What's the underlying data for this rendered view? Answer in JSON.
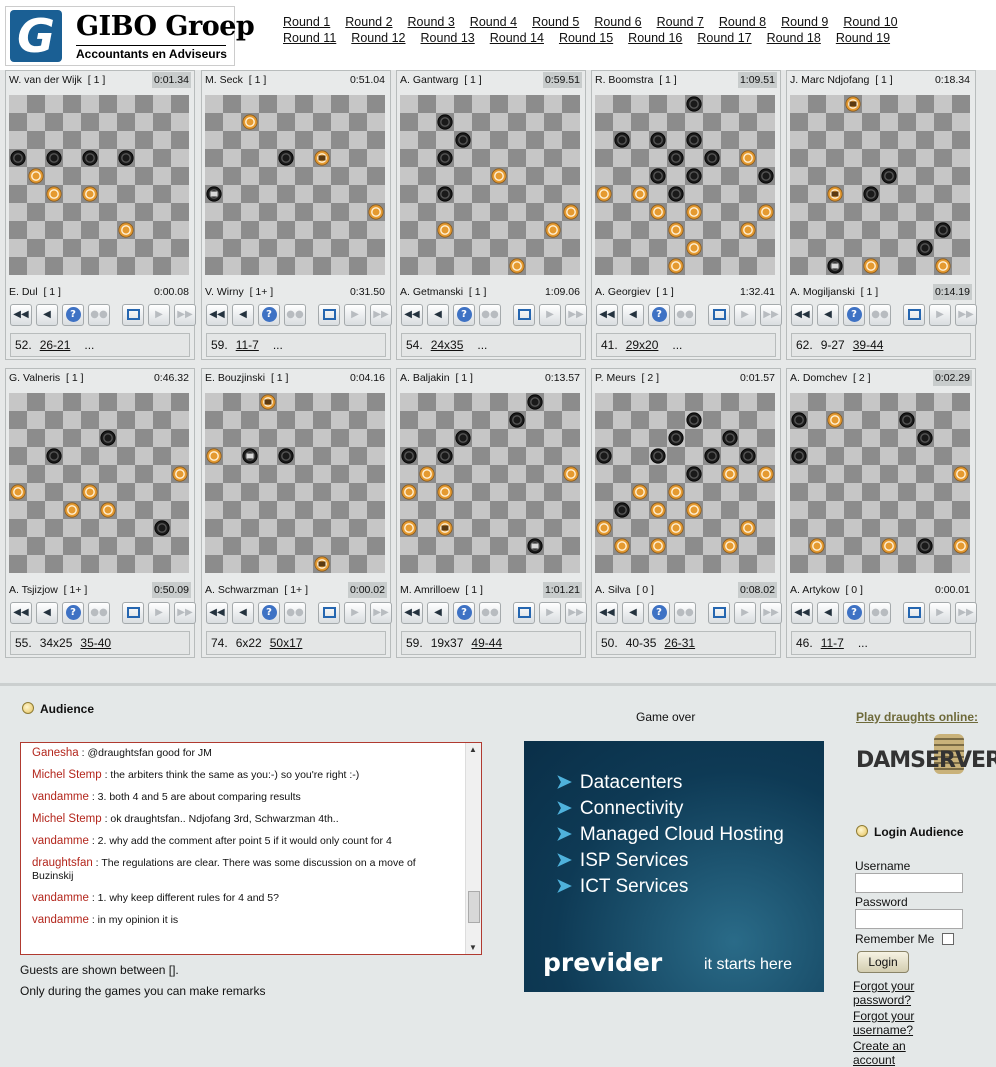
{
  "header": {
    "logo_mark": "G",
    "logo_name": "GIBO Groep",
    "logo_sub": "Accountants en Adviseurs",
    "rounds_row1": [
      "Round 1",
      "Round 2",
      "Round 3",
      "Round 4",
      "Round 5",
      "Round 6",
      "Round 7",
      "Round 8",
      "Round 9",
      "Round 10"
    ],
    "rounds_row2": [
      "Round 11",
      "Round 12",
      "Round 13",
      "Round 14",
      "Round 15",
      "Round 16",
      "Round 17",
      "Round 18",
      "Round 19"
    ]
  },
  "colors": {
    "black_piece": "#1a1a1a",
    "white_piece": "#e59a30",
    "dark_square": "#8c8c8c",
    "light_square": "#c6c6c6",
    "chat_user": "#b3261c",
    "chat_border": "#b03a30"
  },
  "controls": [
    "first-icon",
    "prev-icon",
    "help-icon",
    "pause-icon",
    "flip-icon",
    "next-icon",
    "last-icon"
  ],
  "games": [
    {
      "top": {
        "name": "W. van der Wijk",
        "score": "[ 1 ]",
        "clock": "0:01.34",
        "active": true
      },
      "bottom": {
        "name": "E. Dul",
        "score": "[ 1 ]",
        "clock": "0:00.08",
        "active": false
      },
      "moves": {
        "num": "52.",
        "plain": "",
        "link": "26-21",
        "ellipsis": "..."
      },
      "pieces": [
        {
          "c": 0,
          "r": 3,
          "col": "b"
        },
        {
          "c": 2,
          "r": 3,
          "col": "b"
        },
        {
          "c": 4,
          "r": 3,
          "col": "b"
        },
        {
          "c": 6,
          "r": 3,
          "col": "b"
        },
        {
          "c": 1,
          "r": 4,
          "col": "w"
        },
        {
          "c": 2,
          "r": 5,
          "col": "w"
        },
        {
          "c": 4,
          "r": 5,
          "col": "w"
        },
        {
          "c": 6,
          "r": 7,
          "col": "w"
        }
      ]
    },
    {
      "top": {
        "name": "M. Seck",
        "score": "[ 1 ]",
        "clock": "0:51.04",
        "active": false
      },
      "bottom": {
        "name": "V. Wirny",
        "score": "[ 1+ ]",
        "clock": "0:31.50",
        "active": false
      },
      "moves": {
        "num": "59.",
        "plain": "",
        "link": "11-7",
        "ellipsis": "..."
      },
      "pieces": [
        {
          "c": 2,
          "r": 1,
          "col": "w"
        },
        {
          "c": 4,
          "r": 3,
          "col": "b"
        },
        {
          "c": 6,
          "r": 3,
          "col": "wk"
        },
        {
          "c": 0,
          "r": 5,
          "col": "bk"
        },
        {
          "c": 9,
          "r": 6,
          "col": "w"
        }
      ]
    },
    {
      "top": {
        "name": "A. Gantwarg",
        "score": "[ 1 ]",
        "clock": "0:59.51",
        "active": true
      },
      "bottom": {
        "name": "A. Getmanski",
        "score": "[ 1 ]",
        "clock": "1:09.06",
        "active": false
      },
      "moves": {
        "num": "54.",
        "plain": "",
        "link": "24x35",
        "ellipsis": "..."
      },
      "pieces": [
        {
          "c": 2,
          "r": 1,
          "col": "b"
        },
        {
          "c": 3,
          "r": 2,
          "col": "b"
        },
        {
          "c": 2,
          "r": 3,
          "col": "b"
        },
        {
          "c": 5,
          "r": 4,
          "col": "w"
        },
        {
          "c": 2,
          "r": 5,
          "col": "b"
        },
        {
          "c": 9,
          "r": 6,
          "col": "w"
        },
        {
          "c": 2,
          "r": 7,
          "col": "w"
        },
        {
          "c": 8,
          "r": 7,
          "col": "w"
        },
        {
          "c": 6,
          "r": 9,
          "col": "w"
        }
      ]
    },
    {
      "top": {
        "name": "R. Boomstra",
        "score": "[ 1 ]",
        "clock": "1:09.51",
        "active": true
      },
      "bottom": {
        "name": "A. Georgiev",
        "score": "[ 1 ]",
        "clock": "1:32.41",
        "active": false
      },
      "moves": {
        "num": "41.",
        "plain": "",
        "link": "29x20",
        "ellipsis": "..."
      },
      "pieces": [
        {
          "c": 5,
          "r": 0,
          "col": "b"
        },
        {
          "c": 3,
          "r": 2,
          "col": "b"
        },
        {
          "c": 5,
          "r": 2,
          "col": "b"
        },
        {
          "c": 1,
          "r": 2,
          "col": "b"
        },
        {
          "c": 4,
          "r": 3,
          "col": "b"
        },
        {
          "c": 6,
          "r": 3,
          "col": "b"
        },
        {
          "c": 8,
          "r": 3,
          "col": "w"
        },
        {
          "c": 3,
          "r": 4,
          "col": "b"
        },
        {
          "c": 5,
          "r": 4,
          "col": "b"
        },
        {
          "c": 9,
          "r": 4,
          "col": "b"
        },
        {
          "c": 0,
          "r": 5,
          "col": "w"
        },
        {
          "c": 2,
          "r": 5,
          "col": "w"
        },
        {
          "c": 4,
          "r": 5,
          "col": "b"
        },
        {
          "c": 3,
          "r": 6,
          "col": "w"
        },
        {
          "c": 5,
          "r": 6,
          "col": "w"
        },
        {
          "c": 9,
          "r": 6,
          "col": "w"
        },
        {
          "c": 4,
          "r": 7,
          "col": "w"
        },
        {
          "c": 8,
          "r": 7,
          "col": "w"
        },
        {
          "c": 5,
          "r": 8,
          "col": "w"
        },
        {
          "c": 4,
          "r": 9,
          "col": "w"
        }
      ]
    },
    {
      "top": {
        "name": "J. Marc Ndjofang",
        "score": "[ 1 ]",
        "clock": "0:18.34",
        "active": false
      },
      "bottom": {
        "name": "A. Mogiljanski",
        "score": "[ 1 ]",
        "clock": "0:14.19",
        "active": true
      },
      "moves": {
        "num": "62.",
        "plain": "9-27",
        "link": "39-44",
        "ellipsis": ""
      },
      "pieces": [
        {
          "c": 3,
          "r": 0,
          "col": "wk"
        },
        {
          "c": 5,
          "r": 4,
          "col": "b"
        },
        {
          "c": 2,
          "r": 5,
          "col": "wk"
        },
        {
          "c": 4,
          "r": 5,
          "col": "b"
        },
        {
          "c": 8,
          "r": 7,
          "col": "b"
        },
        {
          "c": 7,
          "r": 8,
          "col": "b"
        },
        {
          "c": 2,
          "r": 9,
          "col": "bk"
        },
        {
          "c": 4,
          "r": 9,
          "col": "w"
        },
        {
          "c": 8,
          "r": 9,
          "col": "w"
        }
      ]
    },
    {
      "top": {
        "name": "G. Valneris",
        "score": "[ 1 ]",
        "clock": "0:46.32",
        "active": false
      },
      "bottom": {
        "name": "A. Tsjizjow",
        "score": "[ 1+ ]",
        "clock": "0:50.09",
        "active": true
      },
      "moves": {
        "num": "55.",
        "plain": "34x25",
        "link": "35-40",
        "ellipsis": ""
      },
      "pieces": [
        {
          "c": 5,
          "r": 2,
          "col": "b"
        },
        {
          "c": 2,
          "r": 3,
          "col": "b"
        },
        {
          "c": 9,
          "r": 4,
          "col": "w"
        },
        {
          "c": 0,
          "r": 5,
          "col": "w"
        },
        {
          "c": 4,
          "r": 5,
          "col": "w"
        },
        {
          "c": 3,
          "r": 6,
          "col": "w"
        },
        {
          "c": 5,
          "r": 6,
          "col": "w"
        },
        {
          "c": 8,
          "r": 7,
          "col": "b"
        }
      ]
    },
    {
      "top": {
        "name": "E. Bouzjinski",
        "score": "[ 1 ]",
        "clock": "0:04.16",
        "active": false
      },
      "bottom": {
        "name": "A. Schwarzman",
        "score": "[ 1+ ]",
        "clock": "0:00.02",
        "active": true
      },
      "moves": {
        "num": "74.",
        "plain": "6x22",
        "link": "50x17",
        "ellipsis": ""
      },
      "pieces": [
        {
          "c": 3,
          "r": 0,
          "col": "wk"
        },
        {
          "c": 0,
          "r": 3,
          "col": "w"
        },
        {
          "c": 2,
          "r": 3,
          "col": "bk"
        },
        {
          "c": 4,
          "r": 3,
          "col": "b"
        },
        {
          "c": 6,
          "r": 9,
          "col": "wk"
        }
      ]
    },
    {
      "top": {
        "name": "A. Baljakin",
        "score": "[ 1 ]",
        "clock": "0:13.57",
        "active": false
      },
      "bottom": {
        "name": "M. Amrilloew",
        "score": "[ 1 ]",
        "clock": "1:01.21",
        "active": true
      },
      "moves": {
        "num": "59.",
        "plain": "19x37",
        "link": "49-44",
        "ellipsis": ""
      },
      "pieces": [
        {
          "c": 7,
          "r": 0,
          "col": "b"
        },
        {
          "c": 6,
          "r": 1,
          "col": "b"
        },
        {
          "c": 3,
          "r": 2,
          "col": "b"
        },
        {
          "c": 0,
          "r": 3,
          "col": "b"
        },
        {
          "c": 2,
          "r": 3,
          "col": "b"
        },
        {
          "c": 1,
          "r": 4,
          "col": "w"
        },
        {
          "c": 9,
          "r": 4,
          "col": "w"
        },
        {
          "c": 0,
          "r": 5,
          "col": "w"
        },
        {
          "c": 2,
          "r": 5,
          "col": "w"
        },
        {
          "c": 0,
          "r": 7,
          "col": "w"
        },
        {
          "c": 2,
          "r": 7,
          "col": "wk"
        },
        {
          "c": 7,
          "r": 8,
          "col": "bk"
        }
      ]
    },
    {
      "top": {
        "name": "P. Meurs",
        "score": "[ 2 ]",
        "clock": "0:01.57",
        "active": false
      },
      "bottom": {
        "name": "A. Silva",
        "score": "[ 0 ]",
        "clock": "0:08.02",
        "active": true
      },
      "moves": {
        "num": "50.",
        "plain": "40-35",
        "link": "26-31",
        "ellipsis": ""
      },
      "pieces": [
        {
          "c": 5,
          "r": 1,
          "col": "b"
        },
        {
          "c": 4,
          "r": 2,
          "col": "b"
        },
        {
          "c": 7,
          "r": 2,
          "col": "b"
        },
        {
          "c": 0,
          "r": 3,
          "col": "b"
        },
        {
          "c": 3,
          "r": 3,
          "col": "b"
        },
        {
          "c": 6,
          "r": 3,
          "col": "b"
        },
        {
          "c": 8,
          "r": 3,
          "col": "b"
        },
        {
          "c": 5,
          "r": 4,
          "col": "b"
        },
        {
          "c": 7,
          "r": 4,
          "col": "w"
        },
        {
          "c": 9,
          "r": 4,
          "col": "w"
        },
        {
          "c": 2,
          "r": 5,
          "col": "w"
        },
        {
          "c": 4,
          "r": 5,
          "col": "w"
        },
        {
          "c": 1,
          "r": 6,
          "col": "b"
        },
        {
          "c": 3,
          "r": 6,
          "col": "w"
        },
        {
          "c": 5,
          "r": 6,
          "col": "w"
        },
        {
          "c": 0,
          "r": 7,
          "col": "w"
        },
        {
          "c": 4,
          "r": 7,
          "col": "w"
        },
        {
          "c": 8,
          "r": 7,
          "col": "w"
        },
        {
          "c": 3,
          "r": 8,
          "col": "w"
        },
        {
          "c": 1,
          "r": 8,
          "col": "w"
        },
        {
          "c": 7,
          "r": 8,
          "col": "w"
        }
      ]
    },
    {
      "top": {
        "name": "A. Domchev",
        "score": "[ 2 ]",
        "clock": "0:02.29",
        "active": true
      },
      "bottom": {
        "name": "A. Artykow",
        "score": "[ 0 ]",
        "clock": "0:00.01",
        "active": false
      },
      "moves": {
        "num": "46.",
        "plain": "",
        "link": "11-7",
        "ellipsis": "..."
      },
      "pieces": [
        {
          "c": 0,
          "r": 1,
          "col": "b"
        },
        {
          "c": 2,
          "r": 1,
          "col": "w"
        },
        {
          "c": 6,
          "r": 1,
          "col": "b"
        },
        {
          "c": 7,
          "r": 2,
          "col": "b"
        },
        {
          "c": 0,
          "r": 3,
          "col": "b"
        },
        {
          "c": 9,
          "r": 4,
          "col": "w"
        },
        {
          "c": 1,
          "r": 8,
          "col": "w"
        },
        {
          "c": 5,
          "r": 8,
          "col": "w"
        },
        {
          "c": 7,
          "r": 8,
          "col": "b"
        },
        {
          "c": 9,
          "r": 8,
          "col": "w"
        }
      ]
    }
  ],
  "audience": {
    "title": "Audience",
    "chat": [
      {
        "user": "Ganesha",
        "text": ": @draughtsfan good for JM"
      },
      {
        "user": "Michel Stemp",
        "text": ": the arbiters think the same as you:-) so you're right :-)"
      },
      {
        "user": "vandamme",
        "text": ": 3. both 4 and 5 are about comparing results"
      },
      {
        "user": "Michel Stemp",
        "text": ": ok draughtsfan.. Ndjofang 3rd, Schwarzman 4th.."
      },
      {
        "user": "vandamme",
        "text": ": 2. why add the comment after point 5 if it would only count for 4"
      },
      {
        "user": "draughtsfan",
        "text": ": The regulations are clear. There was some discussion on a move of Buzinskij"
      },
      {
        "user": "vandamme",
        "text": ": 1. why keep different rules for 4 and 5?"
      },
      {
        "user": "vandamme",
        "text": ": in my opinion it is"
      }
    ],
    "note1": "Guests are shown between [].",
    "note2": "Only during the games you can make remarks"
  },
  "center": {
    "status": "Game over",
    "ad_items": [
      "Datacenters",
      "Connectivity",
      "Managed Cloud Hosting",
      "ISP Services",
      "ICT Services"
    ],
    "ad_brand": "previder",
    "ad_tag": "it starts here"
  },
  "right": {
    "play_link": "Play draughts online:",
    "damserver_logo": "DAMSERVER",
    "login_title": "Login Audience",
    "username_label": "Username",
    "password_label": "Password",
    "remember_label": "Remember Me",
    "login_button": "Login",
    "forgot_password": "Forgot your password?",
    "forgot_username": "Forgot your username?",
    "create_account": "Create an account"
  }
}
